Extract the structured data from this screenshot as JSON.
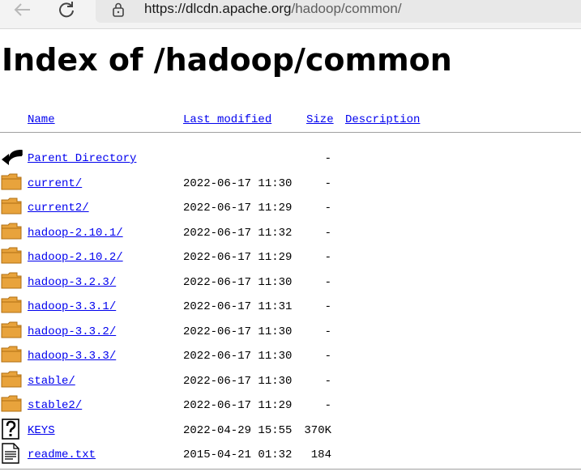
{
  "browser": {
    "url_host": "https://dlcdn.apache.org",
    "url_path": "/hadoop/common/"
  },
  "page": {
    "title": "Index of /hadoop/common"
  },
  "table": {
    "headers": {
      "name": "Name",
      "modified": "Last modified",
      "size": "Size",
      "description": "Description"
    },
    "rows": [
      {
        "icon": "back-arrow-icon",
        "name": "Parent Directory",
        "modified": "",
        "size": "-"
      },
      {
        "icon": "folder-icon",
        "name": "current/",
        "modified": "2022-06-17 11:30",
        "size": "-"
      },
      {
        "icon": "folder-icon",
        "name": "current2/",
        "modified": "2022-06-17 11:29",
        "size": "-"
      },
      {
        "icon": "folder-icon",
        "name": "hadoop-2.10.1/",
        "modified": "2022-06-17 11:32",
        "size": "-"
      },
      {
        "icon": "folder-icon",
        "name": "hadoop-2.10.2/",
        "modified": "2022-06-17 11:29",
        "size": "-"
      },
      {
        "icon": "folder-icon",
        "name": "hadoop-3.2.3/",
        "modified": "2022-06-17 11:30",
        "size": "-"
      },
      {
        "icon": "folder-icon",
        "name": "hadoop-3.3.1/",
        "modified": "2022-06-17 11:31",
        "size": "-"
      },
      {
        "icon": "folder-icon",
        "name": "hadoop-3.3.2/",
        "modified": "2022-06-17 11:30",
        "size": "-"
      },
      {
        "icon": "folder-icon",
        "name": "hadoop-3.3.3/",
        "modified": "2022-06-17 11:30",
        "size": "-"
      },
      {
        "icon": "folder-icon",
        "name": "stable/",
        "modified": "2022-06-17 11:30",
        "size": "-"
      },
      {
        "icon": "folder-icon",
        "name": "stable2/",
        "modified": "2022-06-17 11:29",
        "size": "-"
      },
      {
        "icon": "unknown-file-icon",
        "name": "KEYS",
        "modified": "2022-04-29 15:55",
        "size": "370K"
      },
      {
        "icon": "text-file-icon",
        "name": "readme.txt",
        "modified": "2015-04-21 01:32",
        "size": "184"
      }
    ]
  },
  "colors": {
    "link": "#0000ee",
    "folder": "#e8a33c",
    "folder_dark": "#b06f12"
  }
}
